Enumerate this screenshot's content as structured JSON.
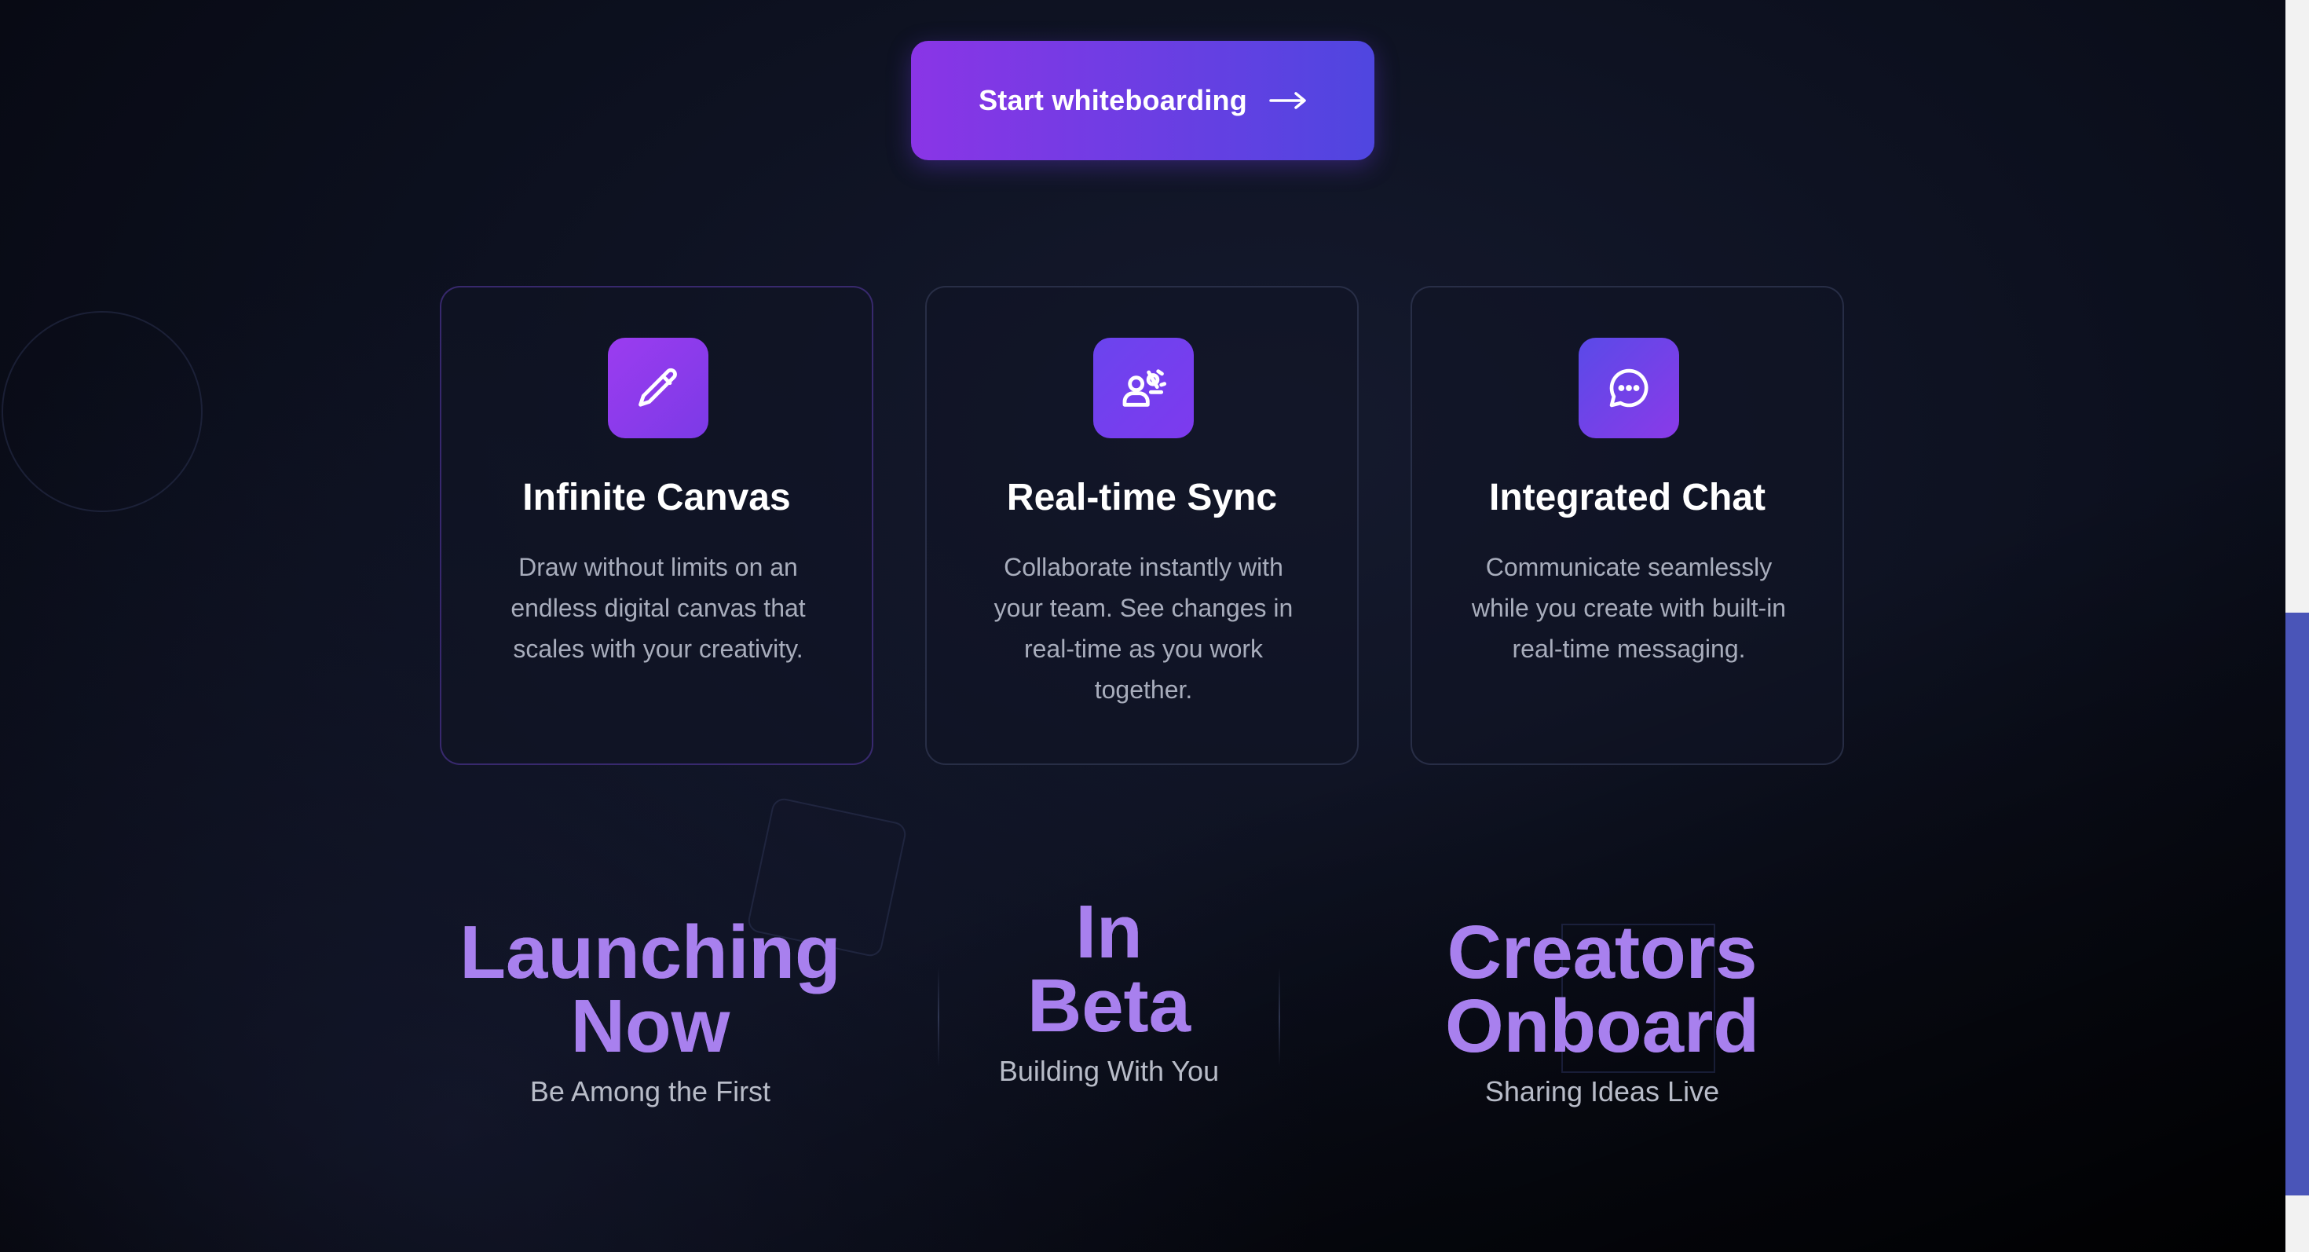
{
  "cta": {
    "label": "Start whiteboarding",
    "icon": "arrow-right-icon"
  },
  "features": [
    {
      "icon": "pencil-icon",
      "title": "Infinite Canvas",
      "description": "Draw without limits on an endless digital canvas that scales with your creativity."
    },
    {
      "icon": "users-sync-icon",
      "title": "Real-time Sync",
      "description": "Collaborate instantly with your team. See changes in real-time as you work together."
    },
    {
      "icon": "chat-bubble-icon",
      "title": "Integrated Chat",
      "description": "Communicate seamlessly while you create with built-in real-time messaging."
    }
  ],
  "stats": [
    {
      "line1": "Launching",
      "line2": "Now",
      "caption": "Be Among the First"
    },
    {
      "line1": "In",
      "line2": "Beta",
      "caption": "Building With You"
    },
    {
      "line1": "Creators",
      "line2": "Onboard",
      "caption": "Sharing Ideas Live"
    }
  ],
  "colors": {
    "accent_start": "#8a35e6",
    "accent_end": "#4f46e0",
    "stat_text": "#a880ee",
    "background": "#0d1120"
  }
}
